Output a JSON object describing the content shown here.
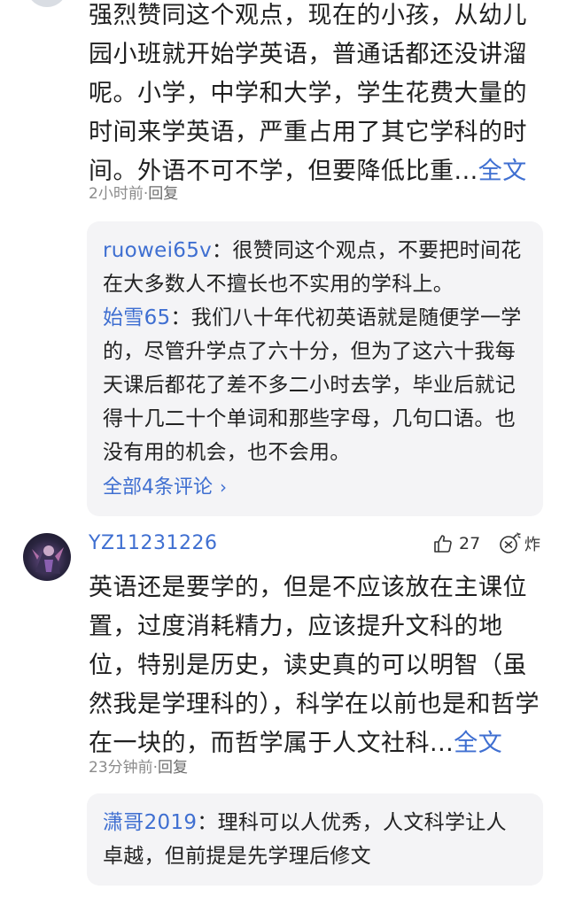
{
  "comment1": {
    "text": "强烈赞同这个观点，现在的小孩，从幼儿园小班就开始学英语，普通话都还没讲溜呢。小学，中学和大学，学生花费大量的时间来学英语，严重占用了其它学科的时间。外语不可不学，但要降低比重...",
    "full_link": "全文",
    "time": "2小时前",
    "separator": "·",
    "reply_label": "回复",
    "replies": [
      {
        "user": "ruowei65v",
        "colon": "：",
        "text": "很赞同这个观点，不要把时间花在大多数人不擅长也不实用的学科上。"
      },
      {
        "user": "始雪65",
        "colon": "：",
        "text": "我们八十年代初英语就是随便学一学的，尽管升学点了六十分，但为了这六十我每天课后都花了差不多二小时去学，毕业后就记得十几二十个单词和那些字母，几句口语。也没有用的机会，也不会用。"
      }
    ],
    "all_comments": "全部4条评论",
    "all_comments_chevron": "›"
  },
  "comment2": {
    "username": "YZ11231226",
    "likes": "27",
    "bomb_label": "炸",
    "text": "英语还是要学的，但是不应该放在主课位置，过度消耗精力，应该提升文科的地位，特别是历史，读史真的可以明智（虽然我是学理科的），科学在以前也是和哲学在一块的，而哲学属于人文社科...",
    "full_link": "全文",
    "time": "23分钟前",
    "separator": "·",
    "reply_label": "回复",
    "replies": [
      {
        "user": "潇哥2019",
        "colon": "：",
        "text": "理科可以人优秀，人文科学让人卓越，但前提是先学理后修文"
      }
    ]
  },
  "icons": {
    "like": "thumbs-up-icon",
    "bomb": "bomb-icon",
    "chevron": "chevron-right-icon"
  },
  "colors": {
    "link": "#3f6fd1",
    "meta": "#8b8b8b",
    "reply_bg": "#f4f4f6"
  }
}
